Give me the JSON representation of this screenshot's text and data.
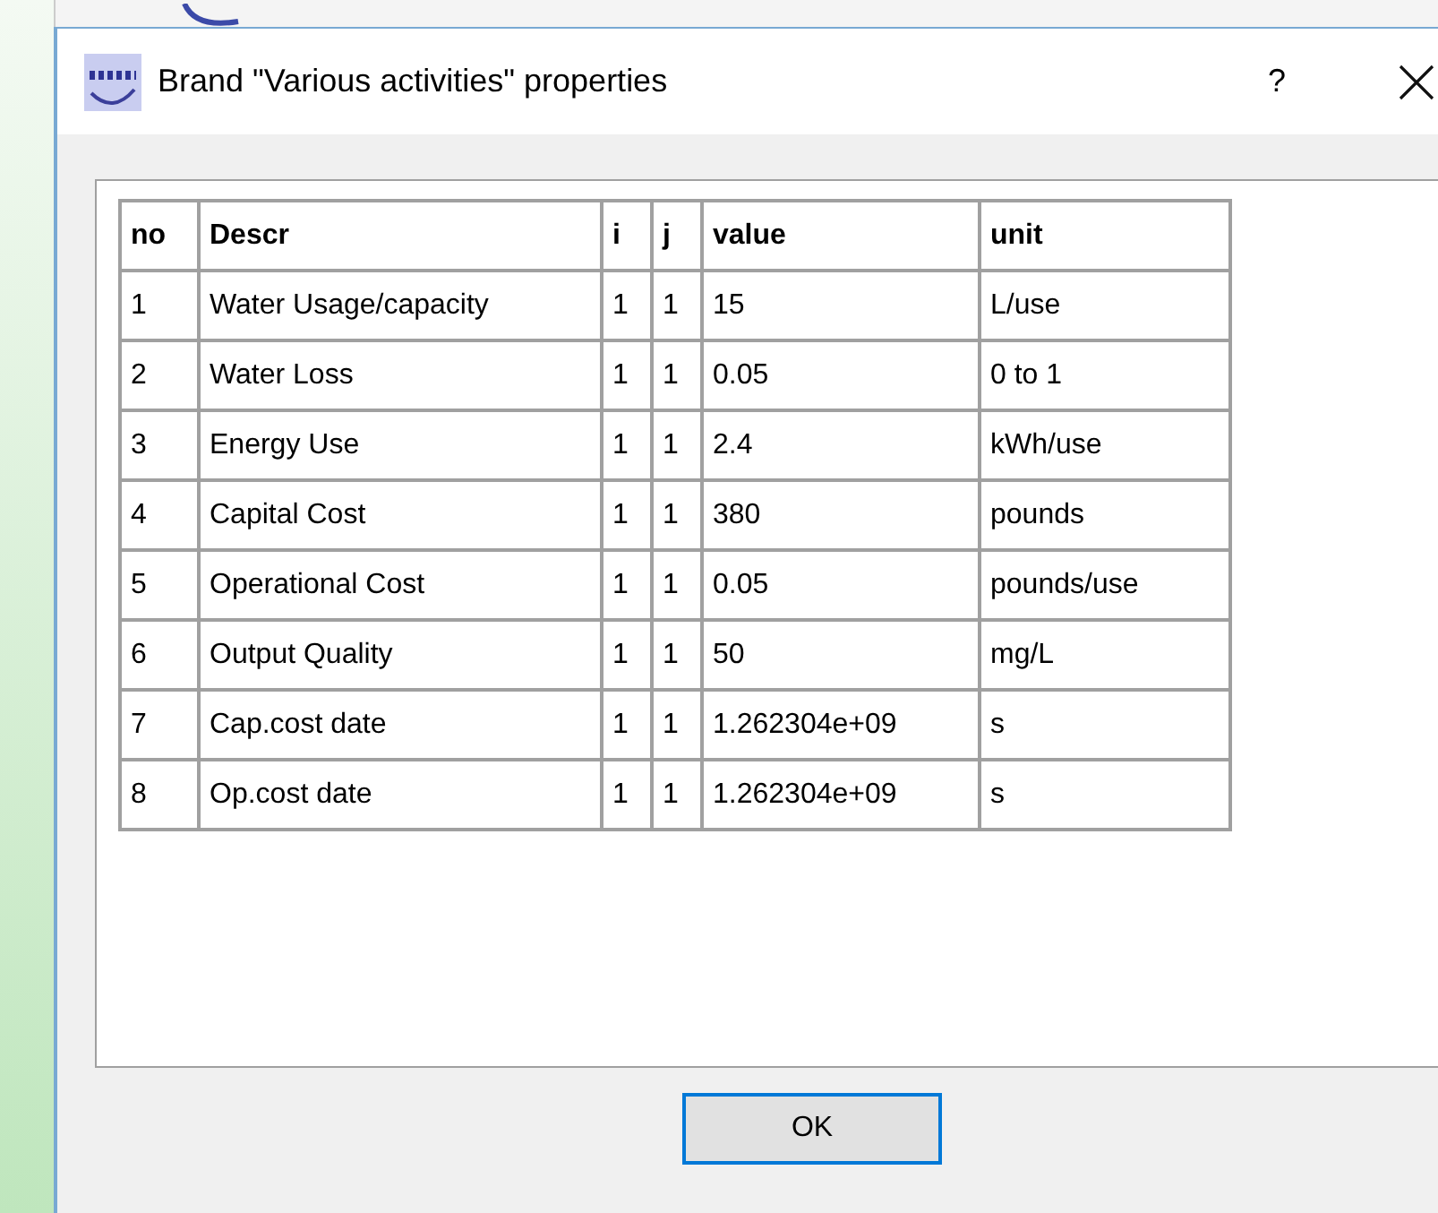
{
  "window": {
    "title": "Brand \"Various activities\" properties",
    "help_button": "?"
  },
  "table": {
    "columns": [
      "no",
      "Descr",
      "i",
      "j",
      "value",
      "unit"
    ],
    "rows": [
      [
        "1",
        "Water Usage/capacity",
        "1",
        "1",
        "15",
        "L/use"
      ],
      [
        "2",
        "Water Loss",
        "1",
        "1",
        "0.05",
        "0 to 1"
      ],
      [
        "3",
        "Energy Use",
        "1",
        "1",
        "2.4",
        "kWh/use"
      ],
      [
        "4",
        "Capital Cost",
        "1",
        "1",
        "380",
        "pounds"
      ],
      [
        "5",
        "Operational Cost",
        "1",
        "1",
        "0.05",
        "pounds/use"
      ],
      [
        "6",
        "Output Quality",
        "1",
        "1",
        "50",
        "mg/L"
      ],
      [
        "7",
        "Cap.cost date",
        "1",
        "1",
        "1.262304e+09",
        "s"
      ],
      [
        "8",
        "Op.cost date",
        "1",
        "1",
        "1.262304e+09",
        "s"
      ]
    ]
  },
  "buttons": [
    "OK"
  ]
}
